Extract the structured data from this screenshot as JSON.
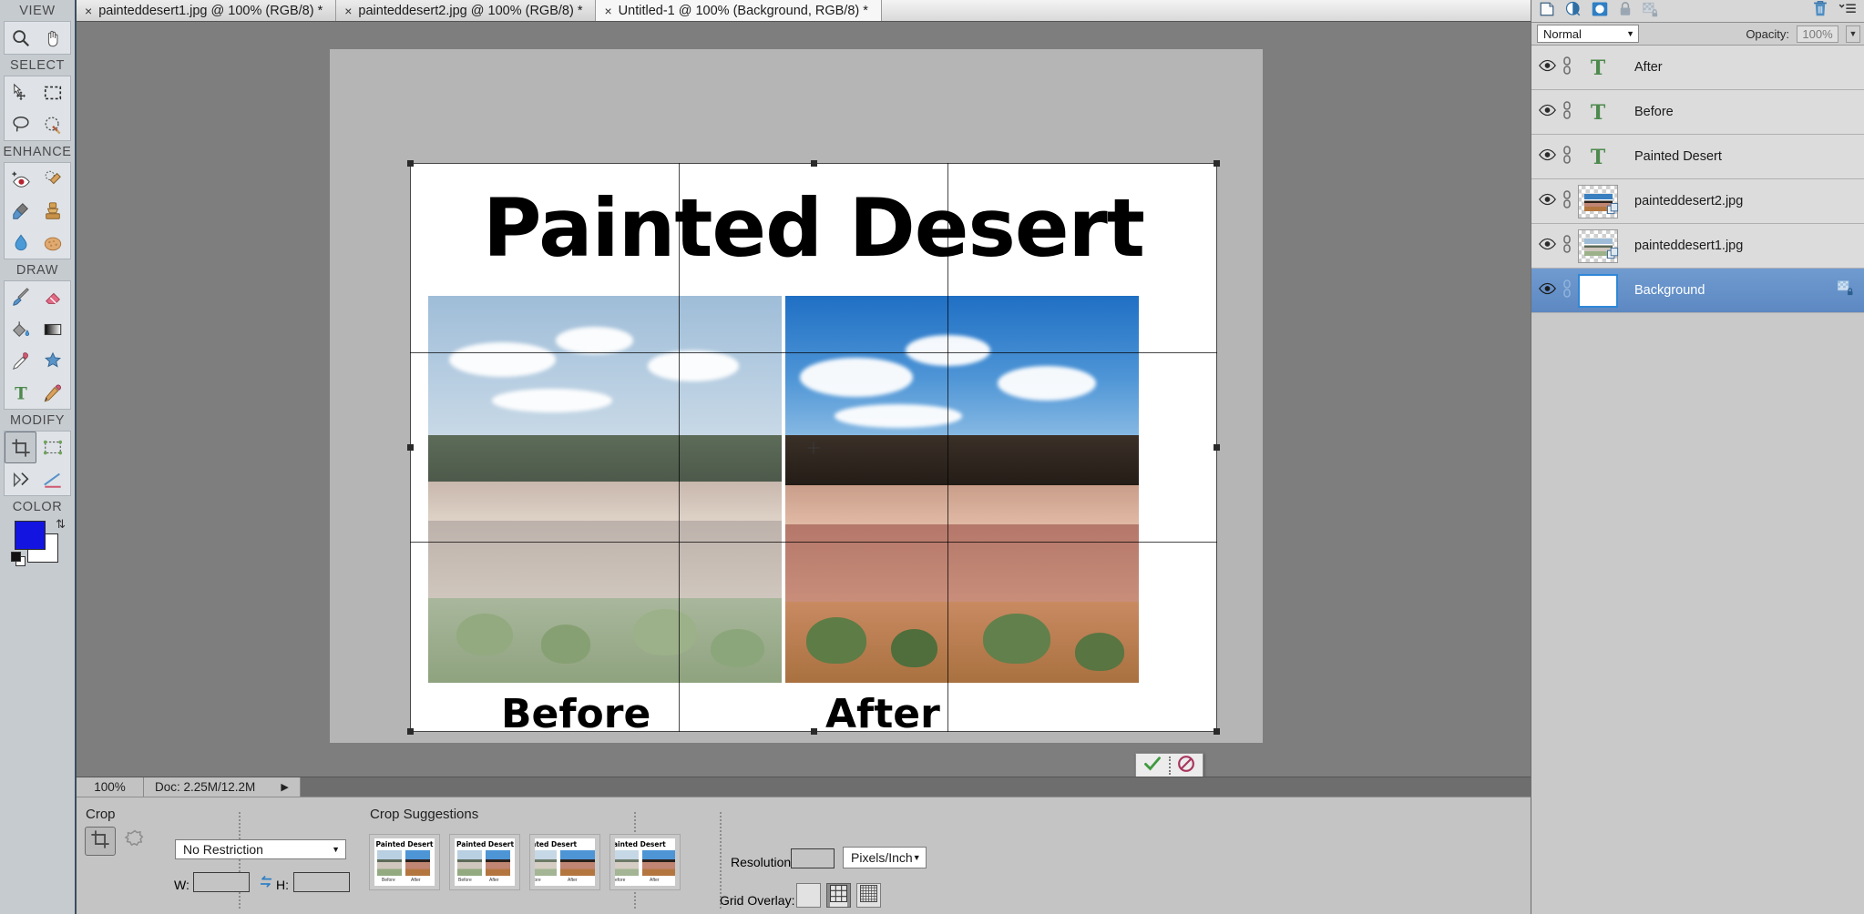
{
  "app": {
    "name": "Photoshop Elements Editor"
  },
  "tabs": [
    {
      "label": "painteddesert1.jpg @ 100% (RGB/8) *",
      "close": "×",
      "active": false
    },
    {
      "label": "painteddesert2.jpg @ 100% (RGB/8) *",
      "close": "×",
      "active": false
    },
    {
      "label": "Untitled-1 @ 100% (Background, RGB/8) *",
      "close": "×",
      "active": true
    }
  ],
  "toolbar": {
    "groups": [
      {
        "label": "VIEW",
        "tools": [
          {
            "name": "zoom-tool",
            "title": "Zoom"
          },
          {
            "name": "hand-tool",
            "title": "Hand"
          }
        ]
      },
      {
        "label": "SELECT",
        "tools": [
          {
            "name": "move-tool",
            "title": "Move"
          },
          {
            "name": "rectangular-marquee-tool",
            "title": "Rectangular Marquee"
          },
          {
            "name": "lasso-tool",
            "title": "Lasso"
          },
          {
            "name": "quick-selection-tool",
            "title": "Quick Selection"
          }
        ]
      },
      {
        "label": "ENHANCE",
        "tools": [
          {
            "name": "red-eye-removal-tool",
            "title": "Red Eye Removal"
          },
          {
            "name": "spot-healing-brush-tool",
            "title": "Spot Healing Brush"
          },
          {
            "name": "smart-brush-tool",
            "title": "Smart Brush"
          },
          {
            "name": "clone-stamp-tool",
            "title": "Clone Stamp"
          },
          {
            "name": "blur-tool",
            "title": "Blur"
          },
          {
            "name": "sponge-tool",
            "title": "Sponge"
          }
        ]
      },
      {
        "label": "DRAW",
        "tools": [
          {
            "name": "brush-tool",
            "title": "Brush"
          },
          {
            "name": "eraser-tool",
            "title": "Eraser"
          },
          {
            "name": "paint-bucket-tool",
            "title": "Paint Bucket"
          },
          {
            "name": "gradient-tool",
            "title": "Gradient"
          },
          {
            "name": "eyedropper-tool",
            "title": "Color Picker"
          },
          {
            "name": "custom-shape-tool",
            "title": "Custom Shape"
          },
          {
            "name": "type-tool",
            "title": "Type"
          },
          {
            "name": "pencil-tool",
            "title": "Pencil"
          }
        ]
      },
      {
        "label": "MODIFY",
        "tools": [
          {
            "name": "crop-tool",
            "title": "Crop",
            "selected": true
          },
          {
            "name": "recompose-tool",
            "title": "Recompose"
          },
          {
            "name": "content-aware-move-tool",
            "title": "Content-Aware Move"
          },
          {
            "name": "straighten-tool",
            "title": "Straighten"
          }
        ]
      },
      {
        "label": "COLOR",
        "tools": []
      }
    ],
    "color": {
      "foreground": "#1414e0",
      "background": "#ffffff",
      "swap_icon": "swap-colors-icon",
      "default_icon": "default-colors-icon"
    }
  },
  "document": {
    "title": "Painted Desert",
    "before_label": "Before",
    "after_label": "After",
    "crop": {
      "grid_overlay": "rule-of-thirds",
      "commit_label": "✓",
      "cancel_label": "⊘"
    }
  },
  "statusbar": {
    "zoom": "100%",
    "doc": "Doc: 2.25M/12.2M",
    "expand_arrow": "▶"
  },
  "options_bar": {
    "section_title": "Crop",
    "suggestions_title": "Crop Suggestions",
    "restriction": {
      "value": "No Restriction",
      "caret": "▼"
    },
    "width": {
      "label": "W:",
      "value": "",
      "placeholder": ""
    },
    "height": {
      "label": "H:",
      "value": "",
      "placeholder": ""
    },
    "swap_icon": "swap-dimensions-icon",
    "resolution": {
      "label": "Resolution:",
      "value": "",
      "unit": "Pixels/Inch",
      "caret": "▼"
    },
    "grid_overlay": {
      "label": "Grid Overlay:",
      "options": [
        "none",
        "rule-of-thirds",
        "grid"
      ],
      "selected": 1
    },
    "suggestions": [
      {
        "title": "Painted Desert",
        "before": "Before",
        "after": "After"
      },
      {
        "title": "Painted Desert",
        "before": "Before",
        "after": "After"
      },
      {
        "title": "nted Desert",
        "before": "fore",
        "after": "After"
      },
      {
        "title": "ainted Desert",
        "before": "efore",
        "after": "After"
      }
    ],
    "right_icons": [
      "help-icon",
      "more-options-icon",
      "collapse-chevron-icon"
    ]
  },
  "layers_panel": {
    "toolbar_icons": [
      "new-layer-icon",
      "adjustment-layer-icon",
      "layer-mask-icon",
      "lock-icon",
      "lock-transparency-icon",
      "delete-layer-icon",
      "panel-menu-icon"
    ],
    "blend_mode": {
      "value": "Normal",
      "caret": "▼"
    },
    "opacity": {
      "label": "Opacity:",
      "value": "100%",
      "caret": "▼"
    },
    "layers": [
      {
        "name": "After",
        "type": "text",
        "visible": true,
        "linked": true,
        "selected": false
      },
      {
        "name": "Before",
        "type": "text",
        "visible": true,
        "linked": true,
        "selected": false
      },
      {
        "name": "Painted Desert",
        "type": "text",
        "visible": true,
        "linked": true,
        "selected": false
      },
      {
        "name": "painteddesert2.jpg",
        "type": "image-after",
        "visible": true,
        "linked": true,
        "selected": false
      },
      {
        "name": "painteddesert1.jpg",
        "type": "image-before",
        "visible": true,
        "linked": true,
        "selected": false
      },
      {
        "name": "Background",
        "type": "background",
        "visible": true,
        "linked": true,
        "selected": true,
        "locked": true
      }
    ]
  },
  "colors": {
    "accent": "#5d88c2",
    "panel_bg": "#c9c9c9",
    "canvas_bg": "#7e7e7e",
    "toolbar_bg": "#c6cbd0"
  }
}
